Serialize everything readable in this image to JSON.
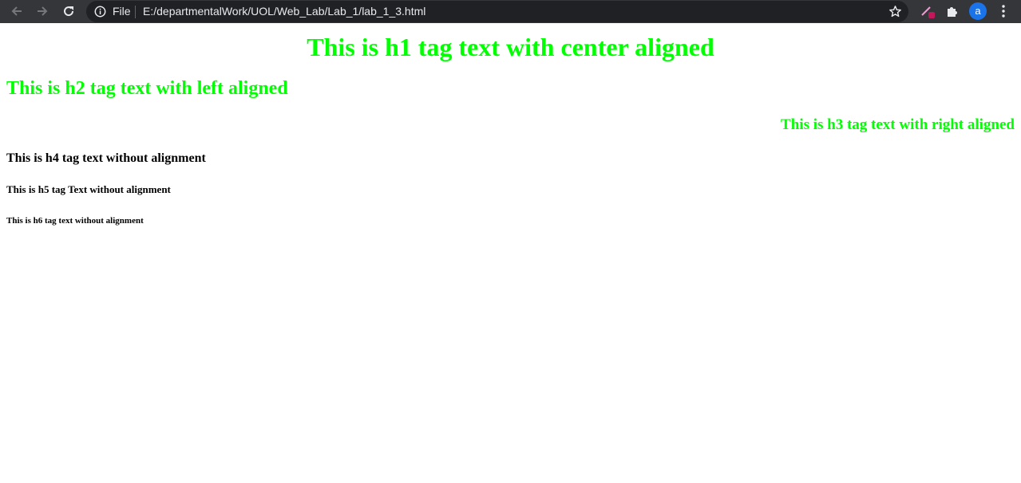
{
  "browser": {
    "scheme_label": "File",
    "url": "E:/departmentalWork/UOL/Web_Lab/Lab_1/lab_1_3.html",
    "avatar_letter": "a",
    "icons": {
      "back": "back-arrow-icon",
      "forward": "forward-arrow-icon",
      "reload": "reload-icon",
      "info": "info-icon",
      "star": "star-icon",
      "extension_pen": "pen-extension-icon",
      "extensions": "puzzle-icon",
      "menu": "kebab-menu-icon"
    }
  },
  "page": {
    "h1": "This is h1 tag text with center aligned",
    "h2": "This is h2 tag text with left aligned",
    "h3": "This is h3 tag text with right aligned",
    "h4": "This is h4 tag text without alignment",
    "h5": "This is h5 tag Text without alignment",
    "h6": "This is h6 tag text without alignment"
  },
  "colors": {
    "green_heading": "#00ff00",
    "black_heading": "#000000",
    "toolbar_bg": "#35363a",
    "omnibox_bg": "#202124",
    "avatar_bg": "#1a73e8"
  }
}
